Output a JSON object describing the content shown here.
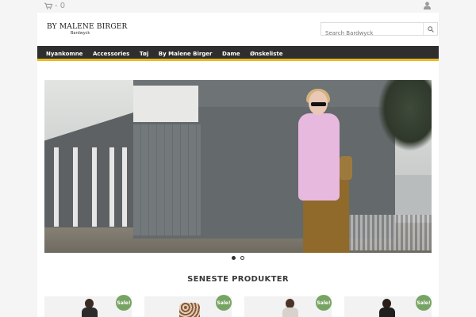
{
  "topbar": {
    "cart_count": "- 0",
    "cart_icon": "shopping-cart-icon",
    "user_icon": "user-icon"
  },
  "header": {
    "logo_main": "BY MALENE BIRGER",
    "logo_sub": "Bardwyck",
    "search_placeholder": "Search Bardwyck",
    "search_icon": "search-icon"
  },
  "nav": {
    "items": [
      "Nyankomne",
      "Accessories",
      "Tøj",
      "By Malene Birger",
      "Dame",
      "Ønskeliste"
    ]
  },
  "slider": {
    "dots": [
      {
        "active": true
      },
      {
        "active": false
      }
    ]
  },
  "products_section": {
    "title": "SENESTE PRODUKTER",
    "badge_label": "Sale!"
  },
  "colors": {
    "nav_bg": "#2e2e2e",
    "nav_accent": "#e8b923",
    "sale_badge": "#77a464"
  }
}
